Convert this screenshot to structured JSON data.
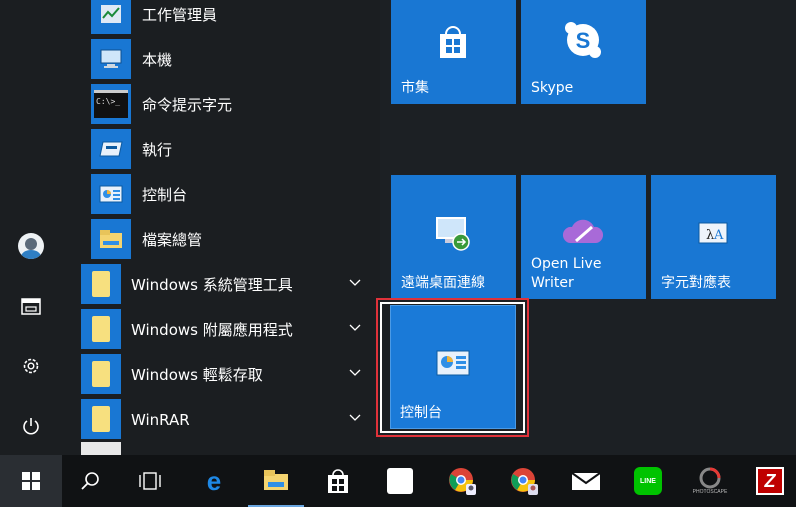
{
  "start_menu": {
    "apps": [
      {
        "label": "工作管理員",
        "icon": "task-manager-icon"
      },
      {
        "label": "本機",
        "icon": "this-pc-icon"
      },
      {
        "label": "命令提示字元",
        "icon": "command-prompt-icon"
      },
      {
        "label": "執行",
        "icon": "run-icon"
      },
      {
        "label": "控制台",
        "icon": "control-panel-icon"
      },
      {
        "label": "檔案總管",
        "icon": "file-explorer-icon"
      }
    ],
    "folders": [
      {
        "label": "Windows 系統管理工具"
      },
      {
        "label": "Windows 附屬應用程式"
      },
      {
        "label": "Windows 輕鬆存取"
      },
      {
        "label": "WinRAR"
      }
    ],
    "cmd_icon_text": "C:\\>_",
    "tiles": {
      "store": "市集",
      "skype": "Skype",
      "remote_desktop": "遠端桌面連線",
      "live_writer": "Open Live Writer",
      "charmap": "字元對應表",
      "control_panel": "控制台"
    },
    "rail": [
      "user-avatar",
      "documents-icon",
      "settings-icon",
      "power-icon"
    ]
  },
  "taskbar": {
    "items": [
      "start-icon",
      "search-icon",
      "task-view-icon",
      "edge-icon",
      "file-explorer-icon",
      "store-icon",
      "app-grid-icon",
      "chrome-user-icon",
      "chrome-user2-icon",
      "mail-icon",
      "line-icon",
      "photoscape-icon",
      "filezilla-icon"
    ],
    "line_label": "LINE",
    "photoscape_label": "PHOTOSCAPE"
  },
  "colors": {
    "tile_blue": "#1977d3",
    "selection_red": "#e0323a",
    "background": "#1b1e21"
  }
}
